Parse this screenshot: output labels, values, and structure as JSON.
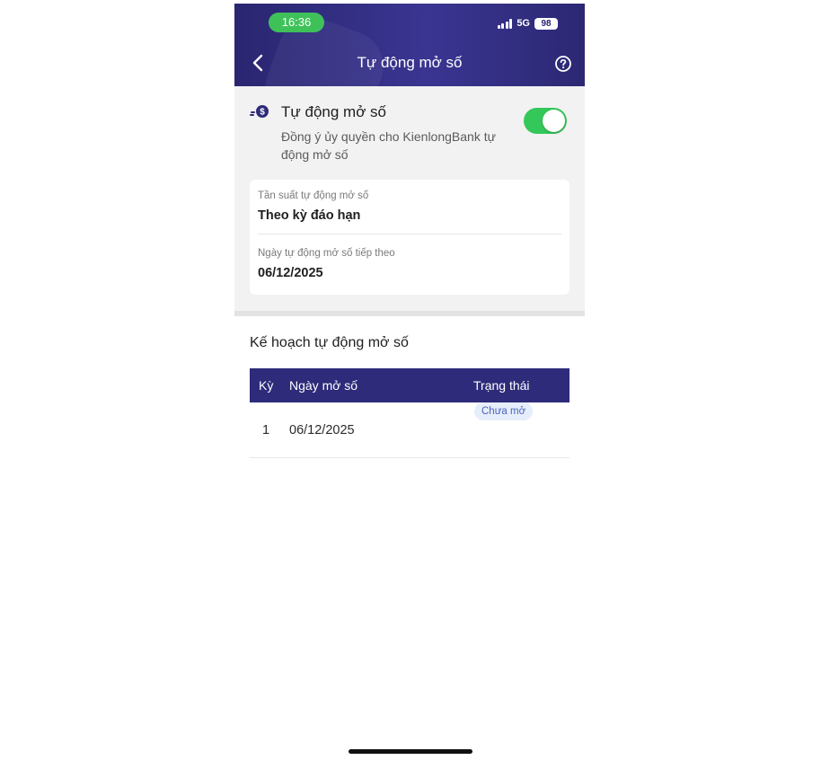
{
  "status_bar": {
    "time": "16:36",
    "network": "5G",
    "battery": "98"
  },
  "nav": {
    "title": "Tự động mở số",
    "back_icon": "chevron-left-icon",
    "help_icon": "question-circle-icon"
  },
  "auto_open": {
    "title": "Tự động mở số",
    "description": "Đồng ý ủy quyền cho KienlongBank tự động mở số",
    "enabled": true,
    "icon": "coin-icon"
  },
  "info": {
    "frequency_label": "Tần suất tự động mở số",
    "frequency_value": "Theo kỳ đáo hạn",
    "next_date_label": "Ngày tự động mở số tiếp theo",
    "next_date_value": "06/12/2025"
  },
  "plan": {
    "title": "Kế hoạch tự động mở số",
    "columns": [
      "Kỳ",
      "Ngày mở số",
      "Trạng thái"
    ],
    "rows": [
      {
        "period": "1",
        "date": "06/12/2025",
        "status": "Chưa mở"
      }
    ]
  },
  "colors": {
    "header": "#2e2b7a",
    "toggle_on": "#34c759",
    "time_pill": "#3fc15a",
    "badge_bg": "#e7eefb",
    "badge_text": "#4a64b8"
  }
}
